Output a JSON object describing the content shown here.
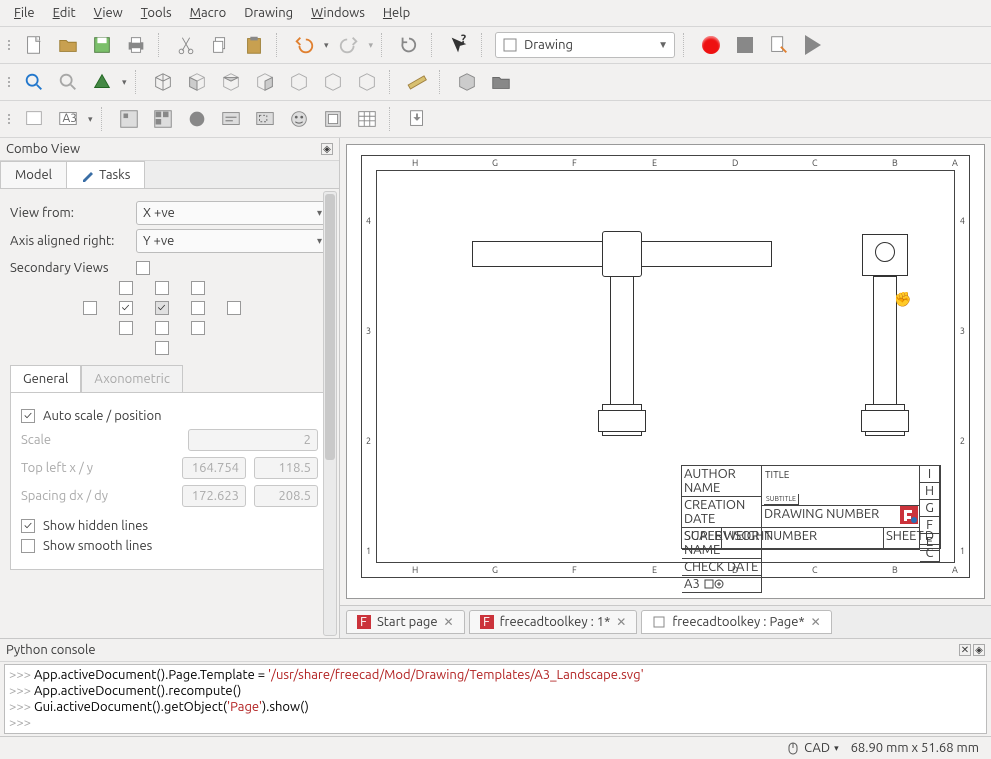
{
  "menu": {
    "file": "File",
    "edit": "Edit",
    "view": "View",
    "tools": "Tools",
    "macro": "Macro",
    "drawing": "Drawing",
    "windows": "Windows",
    "help": "Help"
  },
  "workbench": {
    "selected": "Drawing"
  },
  "combo_view": {
    "title": "Combo View",
    "tabs": {
      "model": "Model",
      "tasks": "Tasks"
    },
    "task": {
      "view_from_label": "View from:",
      "view_from_value": "X +ve",
      "axis_right_label": "Axis aligned right:",
      "axis_right_value": "Y +ve",
      "secondary_views": "Secondary Views",
      "subtabs": {
        "general": "General",
        "axonometric": "Axonometric"
      },
      "auto_scale": "Auto scale / position",
      "scale_label": "Scale",
      "scale_value": "2",
      "topleft_label": "Top left x / y",
      "topleft_x": "164.754",
      "topleft_y": "118.5",
      "spacing_label": "Spacing dx / dy",
      "spacing_dx": "172.623",
      "spacing_dy": "208.5",
      "show_hidden": "Show hidden lines",
      "show_smooth": "Show smooth lines"
    }
  },
  "titleblock": {
    "author": "AUTHOR NAME",
    "creation": "CREATION DATE",
    "supervisor": "SUPERVISOR NAME",
    "checkdate": "CHECK DATE",
    "format": "A3",
    "scale": "SCALE",
    "weight": "WEIGHT",
    "number_hdr": "NUMBER",
    "drawing_number": "DRAWING NUMBER",
    "sheet": "SHEET",
    "title": "TITLE",
    "subtitle": "SUBTITLE"
  },
  "doc_tabs": {
    "start": "Start page",
    "doc1": "freecadtoolkey : 1*",
    "doc2": "freecadtoolkey : Page*"
  },
  "python_console": {
    "title": "Python console",
    "lines": [
      {
        "pre": ">>> ",
        "code": "App.activeDocument().Page.Template  = ",
        "str": "'/usr/share/freecad/Mod/Drawing/Templates/A3_Landscape.svg'"
      },
      {
        "pre": ">>> ",
        "code": "App.activeDocument().recompute()"
      },
      {
        "pre": ">>> ",
        "code": "Gui.activeDocument().getObject(",
        "str": "'Page'",
        "code2": ").show()"
      },
      {
        "pre": ">>> ",
        "code": ""
      }
    ]
  },
  "statusbar": {
    "cad": "CAD",
    "coords": "68.90 mm x 51.68 mm"
  }
}
